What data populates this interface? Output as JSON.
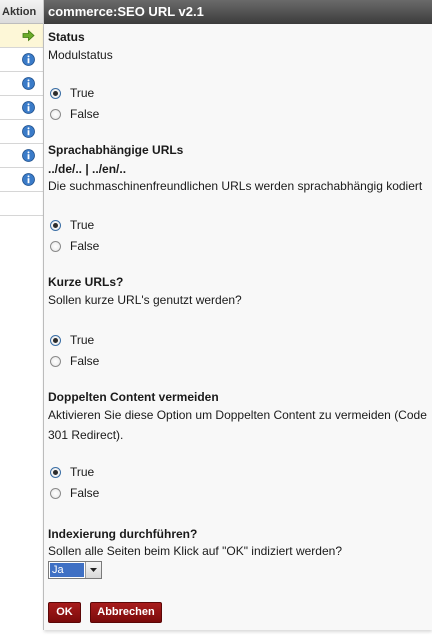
{
  "sidebar": {
    "header": "Aktion",
    "rows": [
      {
        "icon": "arrow-right-icon",
        "active": true
      },
      {
        "icon": "info-icon",
        "active": false
      },
      {
        "icon": "info-icon",
        "active": false
      },
      {
        "icon": "info-icon",
        "active": false
      },
      {
        "icon": "info-icon",
        "active": false
      },
      {
        "icon": "info-icon",
        "active": false
      },
      {
        "icon": "info-icon",
        "active": false
      }
    ]
  },
  "panel": {
    "title": "commerce:SEO URL v2.1",
    "sections": [
      {
        "title": "Status",
        "description": [
          "Modulstatus"
        ],
        "options": [
          "True",
          "False"
        ],
        "selected": "True"
      },
      {
        "title": "Sprachabhängige URLs",
        "description": [
          "../de/.. | ../en/..",
          "Die suchmaschinenfreundlichen URLs werden sprachabhängig kodiert"
        ],
        "options": [
          "True",
          "False"
        ],
        "selected": "True"
      },
      {
        "title": "Kurze URLs?",
        "description": [
          "Sollen kurze URL's genutzt werden?"
        ],
        "options": [
          "True",
          "False"
        ],
        "selected": "True"
      },
      {
        "title": "Doppelten Content vermeiden",
        "description": [
          "Aktivieren Sie diese Option um Doppelten Content zu vermeiden (Code",
          "301 Redirect)."
        ],
        "options": [
          "True",
          "False"
        ],
        "selected": "True"
      },
      {
        "title": "Indexierung durchführen?",
        "description": [
          "Sollen alle Seiten beim Klick auf \"OK\" indiziert werden?"
        ]
      }
    ],
    "index_select": {
      "value": "Ja"
    },
    "buttons": {
      "ok": "OK",
      "cancel": "Abbrechen"
    }
  },
  "colors": {
    "button_bg": "#8b1010",
    "header_bg": "#4a4a4a",
    "active_row": "#fdf7d7",
    "info_icon": "#2f6fb5",
    "arrow_icon": "#5a9c1e"
  }
}
